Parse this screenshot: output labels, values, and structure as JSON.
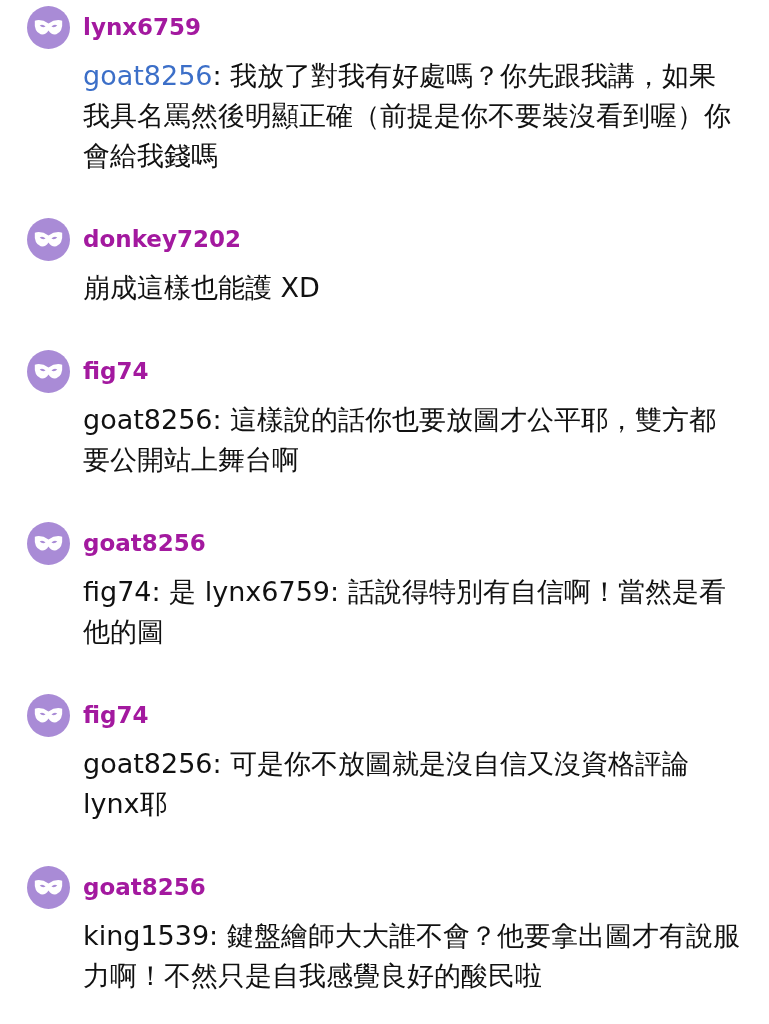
{
  "comments": [
    {
      "username": "lynx6759",
      "mention": "goat8256",
      "text": ": 我放了對我有好處嗎？你先跟我講，如果我具名罵然後明顯正確（前提是你不要裝沒看到喔）你會給我錢嗎"
    },
    {
      "username": "donkey7202",
      "text": "崩成這樣也能護 XD"
    },
    {
      "username": "fig74",
      "text": "goat8256: 這樣說的話你也要放圖才公平耶，雙方都要公開站上舞台啊"
    },
    {
      "username": "goat8256",
      "text": "fig74: 是 lynx6759: 話說得特別有自信啊！當然是看他的圖"
    },
    {
      "username": "fig74",
      "text": "goat8256: 可是你不放圖就是沒自信又沒資格評論 lynx耶"
    },
    {
      "username": "goat8256",
      "text": "king1539: 鍵盤繪師大大誰不會？他要拿出圖才有說服力啊！不然只是自我感覺良好的酸民啦"
    }
  ]
}
